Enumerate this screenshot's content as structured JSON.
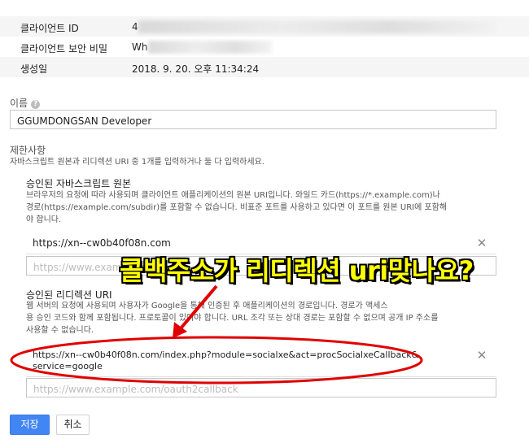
{
  "client_info": {
    "client_id_label": "클라이언트 ID",
    "client_id_value": "4",
    "client_secret_label": "클라이언트 보안 비밀",
    "client_secret_value": "Wh",
    "created_label": "생성일",
    "created_value": "2018. 9. 20. 오후 11:34:24"
  },
  "name_field": {
    "label": "이름",
    "value": "GGUMDONGSAN Developer"
  },
  "restrictions": {
    "title": "제한사항",
    "description": "자바스크립트 원본과 리디렉션 URI 중 1개를 입력하거나 둘 다 입력하세요."
  },
  "js_origins": {
    "title": "승인된 자바스크립트 원본",
    "description_line1": "브라우저의 요청에 따라 사용되며 클라이언트 애플리케이션의 원본 URI입니다. 와일드 카드(https://*.example.com)나",
    "description_line2": "경로(https://example.com/subdir)를 포함할 수 없습니다. 비표준 포트를 사용하고 있다면 이 포트를 원본 URI에 포함해",
    "description_line3": "야 합니다.",
    "entry": "https://xn--cw0b40f08n.com",
    "input_placeholder": "https://www.example.com"
  },
  "redirect_uris": {
    "title": "승인된 리디렉션 URI",
    "description_line1": "웹 서버의 요청에 사용되며 사용자가 Google을 통해 인증된 후 애플리케이션의 경로입니다. 경로가 액세스",
    "description_line2": "용 승인 코드와 함께 포함됩니다. 프로토콜이 있어야 합니다. URL 조각 또는 상대 경로는 포함할 수 없으며 공개 IP 주소를",
    "description_line3": "사용할 수 없습니다.",
    "entry_line1": "https://xn--cw0b40f08n.com/index.php?module=socialxe&act=procSocialxeCallback&",
    "entry_line2": "service=google",
    "input_placeholder": "https://www.example.com/oauth2callback"
  },
  "annotation": {
    "text": "콜백주소가 리디렉션 uri맞나요?",
    "color": "#ffff00",
    "circle_color": "#e00000"
  },
  "buttons": {
    "save": "저장",
    "cancel": "취소"
  },
  "icons": {
    "help": "help-icon",
    "remove": "close-icon"
  },
  "colors": {
    "primary": "#4285f4"
  }
}
